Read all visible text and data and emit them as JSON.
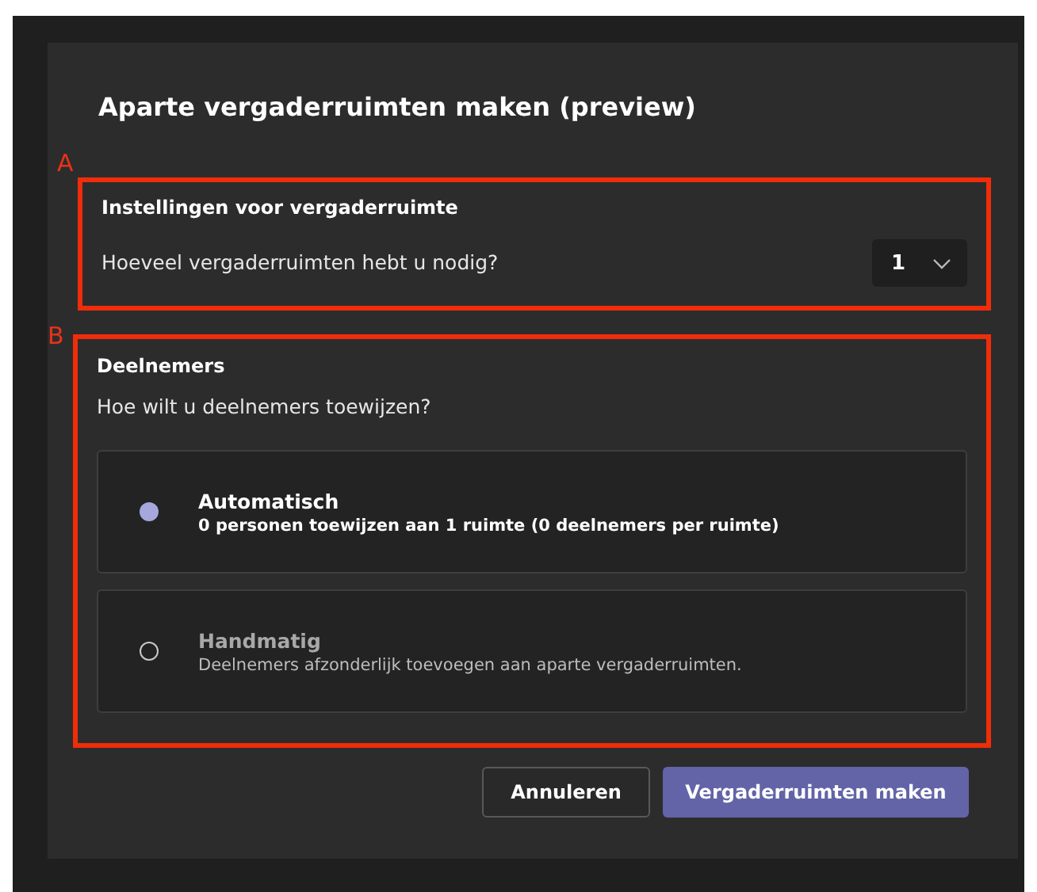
{
  "dialog": {
    "title": "Aparte vergaderruimten maken (preview)"
  },
  "settings": {
    "marker": "A",
    "heading": "Instellingen voor vergaderruimte",
    "question": "Hoeveel vergaderruimten hebt u nodig?",
    "count": {
      "value": "1"
    }
  },
  "participants": {
    "marker": "B",
    "heading": "Deelnemers",
    "question": "Hoe wilt u deelnemers toewijzen?",
    "options": [
      {
        "label": "Automatisch",
        "description": "0 personen toewijzen aan 1 ruimte (0 deelnemers per ruimte)",
        "selected": true
      },
      {
        "label": "Handmatig",
        "description": "Deelnemers afzonderlijk toevoegen aan aparte vergaderruimten.",
        "selected": false
      }
    ]
  },
  "buttons": [
    {
      "label": "Annuleren",
      "kind": "secondary"
    },
    {
      "label": "Vergaderruimten maken",
      "kind": "primary"
    }
  ]
}
